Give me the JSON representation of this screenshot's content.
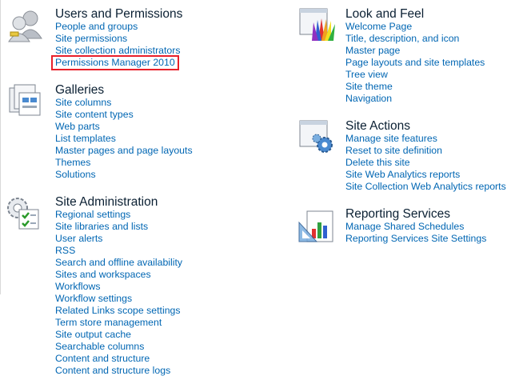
{
  "users_permissions": {
    "title": "Users and Permissions",
    "links": [
      "People and groups",
      "Site permissions",
      "Site collection administrators",
      "Permissions Manager 2010"
    ]
  },
  "galleries": {
    "title": "Galleries",
    "links": [
      "Site columns",
      "Site content types",
      "Web parts",
      "List templates",
      "Master pages and page layouts",
      "Themes",
      "Solutions"
    ]
  },
  "site_administration": {
    "title": "Site Administration",
    "links": [
      "Regional settings",
      "Site libraries and lists",
      "User alerts",
      "RSS",
      "Search and offline availability",
      "Sites and workspaces",
      "Workflows",
      "Workflow settings",
      "Related Links scope settings",
      "Term store management",
      "Site output cache",
      "Searchable columns",
      "Content and structure",
      "Content and structure logs"
    ]
  },
  "look_and_feel": {
    "title": "Look and Feel",
    "links": [
      "Welcome Page",
      "Title, description, and icon",
      "Master page",
      "Page layouts and site templates",
      "Tree view",
      "Site theme",
      "Navigation"
    ]
  },
  "site_actions": {
    "title": "Site Actions",
    "links": [
      "Manage site features",
      "Reset to site definition",
      "Delete this site",
      "Site Web Analytics reports",
      "Site Collection Web Analytics reports"
    ]
  },
  "reporting_services": {
    "title": "Reporting Services",
    "links": [
      "Manage Shared Schedules",
      "Reporting Services Site Settings"
    ]
  },
  "colors": {
    "link": "#0066b3",
    "heading": "#0b2033",
    "highlight": "#e8202a"
  },
  "icons": [
    "users-icon",
    "galleries-icon",
    "site-admin-icon",
    "look-feel-icon",
    "site-actions-icon",
    "reporting-icon"
  ]
}
